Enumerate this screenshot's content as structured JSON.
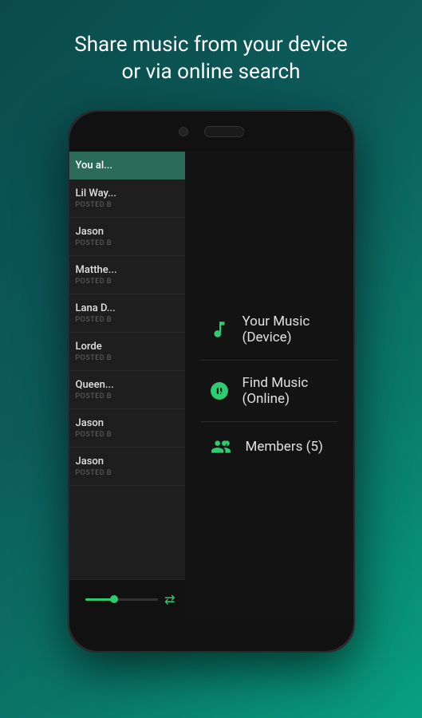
{
  "header": {
    "line1": "Share music from your device",
    "line2": "or via online search"
  },
  "left_panel": {
    "you_also_label": "You al...",
    "tracks": [
      {
        "name": "Lil Way...",
        "posted": "POSTED B"
      },
      {
        "name": "Jason",
        "posted": "POSTED B"
      },
      {
        "name": "Matthe...",
        "posted": "POSTED B"
      },
      {
        "name": "Lana D...",
        "posted": "POSTED B"
      },
      {
        "name": "Lorde",
        "posted": "POSTED B"
      },
      {
        "name": "Queen...",
        "posted": "POSTED B"
      },
      {
        "name": "Jason",
        "posted": "POSTED B"
      },
      {
        "name": "Jason",
        "posted": "POSTED B"
      }
    ]
  },
  "menu": {
    "items": [
      {
        "label": "Your Music (Device)",
        "icon": "music-note"
      },
      {
        "label": "Find Music (Online)",
        "icon": "find-music"
      },
      {
        "label": "Members (5)",
        "icon": "members"
      }
    ]
  },
  "accent_color": "#2ecc71"
}
